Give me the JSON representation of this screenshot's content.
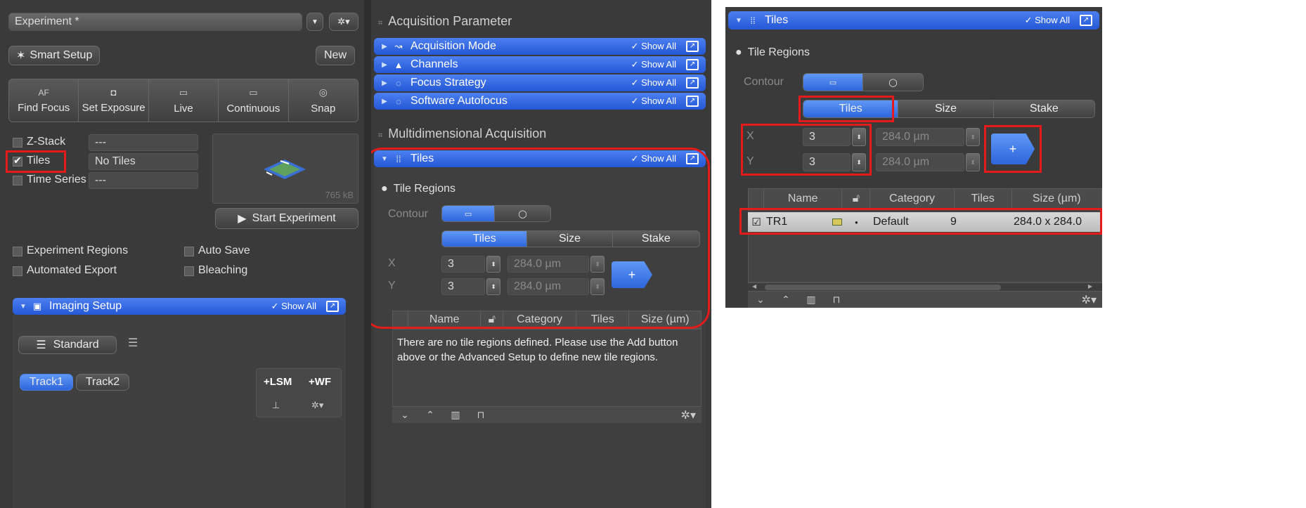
{
  "left": {
    "experiment_name": "Experiment *",
    "smart_setup": "Smart Setup",
    "new_btn": "New",
    "actions": [
      {
        "icon_text": "AF",
        "label": "Find Focus",
        "icon": "af-icon"
      },
      {
        "icon_text": "◘",
        "label": "Set Exposure",
        "icon": "camera-icon"
      },
      {
        "icon_text": "▭",
        "label": "Live",
        "icon": "live-icon"
      },
      {
        "icon_text": "▭",
        "label": "Continuous",
        "icon": "continuous-icon"
      },
      {
        "icon_text": "◎",
        "label": "Snap",
        "icon": "snap-icon"
      }
    ],
    "zstack_label": "Z-Stack",
    "zstack_value": "---",
    "tiles_label": "Tiles",
    "tiles_value": "No Tiles",
    "timeseries_label": "Time Series",
    "timeseries_value": "---",
    "preview_size": "765 kB",
    "start_experiment": "Start Experiment",
    "experiment_regions": "Experiment Regions",
    "auto_save": "Auto Save",
    "automated_export": "Automated Export",
    "bleaching": "Bleaching",
    "imaging_setup": "Imaging Setup",
    "show_all": "Show All",
    "standard": "Standard",
    "track1": "Track1",
    "track2": "Track2",
    "add_lsm": "+LSM",
    "add_wf": "+WF"
  },
  "middle": {
    "acq_param_title": "Acquisition Parameter",
    "sections": [
      "Acquisition Mode",
      "Channels",
      "Focus Strategy",
      "Software Autofocus"
    ],
    "multi_title": "Multidimensional Acquisition",
    "tiles_header": "Tiles",
    "show_all": "Show All",
    "tile_regions": "Tile Regions",
    "contour": "Contour",
    "tabs": [
      "Tiles",
      "Size",
      "Stake"
    ],
    "x_label": "X",
    "y_label": "Y",
    "x_value": "3",
    "y_value": "3",
    "x_size": "284.0 µm",
    "y_size": "284.0 µm",
    "plus": "+",
    "columns": [
      "Name",
      "Category",
      "Tiles",
      "Size (µm)"
    ],
    "empty_msg": "There are no tile regions defined. Please use the Add button above or the Advanced Setup to define new tile regions."
  },
  "right": {
    "tiles_header": "Tiles",
    "show_all": "Show All",
    "tile_regions": "Tile Regions",
    "contour": "Contour",
    "tabs": [
      "Tiles",
      "Size",
      "Stake"
    ],
    "x_label": "X",
    "y_label": "Y",
    "x_value": "3",
    "y_value": "3",
    "x_size": "284.0 µm",
    "y_size": "284.0 µm",
    "plus": "+",
    "columns": [
      "Name",
      "Category",
      "Tiles",
      "Size (µm)"
    ],
    "row": {
      "name": "TR1",
      "category": "Default",
      "tiles": "9",
      "size": "284.0 x 284.0"
    }
  },
  "colors": {
    "accent_blue": "#2e66dc",
    "highlight_red": "#e51b1b",
    "panel_dark": "#3a3a3a"
  }
}
